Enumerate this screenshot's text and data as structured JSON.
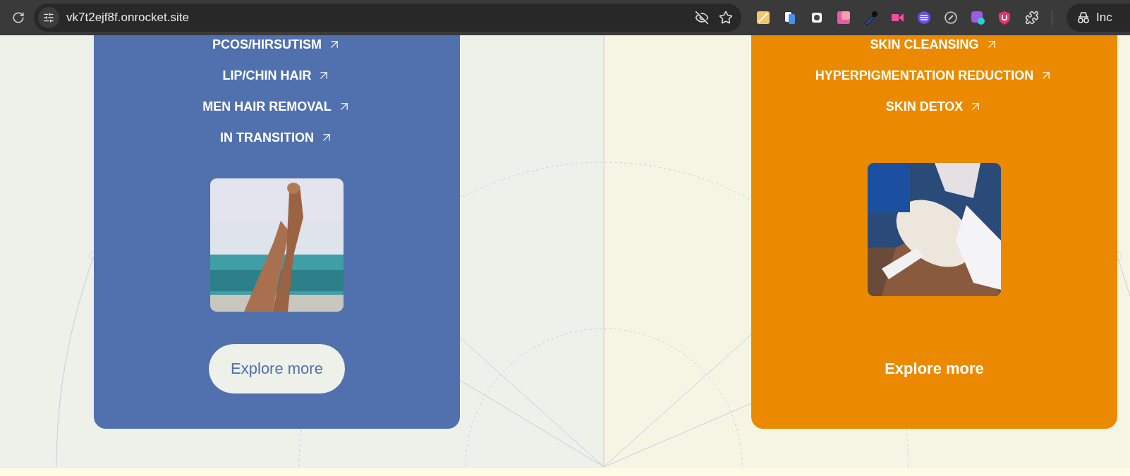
{
  "browser": {
    "url": "vk7t2ejf8f.onrocket.site",
    "profile_label": "Inc"
  },
  "cards": [
    {
      "color": "#5070ae",
      "links": [
        "PCOS/HIRSUTISM",
        "LIP/CHIN HAIR",
        "MEN HAIR REMOVAL",
        "IN TRANSITION"
      ],
      "button": {
        "label": "Explore more",
        "filled": true
      }
    },
    {
      "color": "#eb8a00",
      "links": [
        "SKIN CLEANSING",
        "HYPERPIGMENTATION REDUCTION",
        "SKIN DETOX"
      ],
      "button": {
        "label": "Explore more",
        "filled": false
      }
    }
  ]
}
